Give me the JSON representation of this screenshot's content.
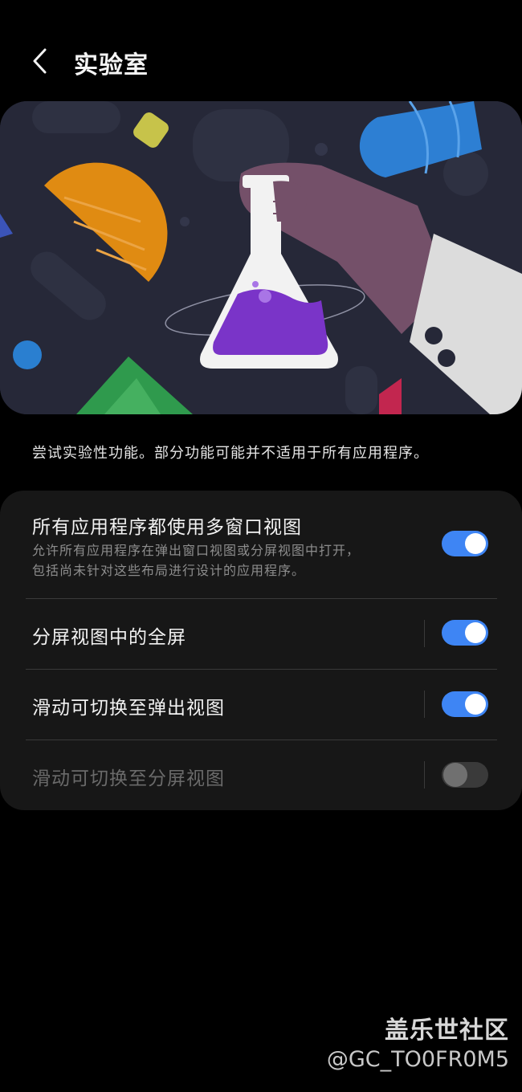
{
  "header": {
    "back_icon": "chevron-left-icon",
    "title": "实验室"
  },
  "description": "尝试实验性功能。部分功能可能并不适用于所有应用程序。",
  "settings": [
    {
      "title": "所有应用程序都使用多窗口视图",
      "subtitle_line1": "允许所有应用程序在弹出窗口视图或分屏视图中打开，",
      "subtitle_line2": "包括尚未针对这些布局进行设计的应用程序。",
      "enabled": true,
      "disabled": false
    },
    {
      "title": "分屏视图中的全屏",
      "enabled": true,
      "disabled": false
    },
    {
      "title": "滑动可切换至弹出视图",
      "enabled": true,
      "disabled": false
    },
    {
      "title": "滑动可切换至分屏视图",
      "enabled": false,
      "disabled": true
    }
  ],
  "colors": {
    "accent": "#3e85f4",
    "card_background": "#171717",
    "background": "#000000"
  },
  "watermark": {
    "brand": "盖乐世社区",
    "user": "@GC_TO0FR0M5"
  }
}
